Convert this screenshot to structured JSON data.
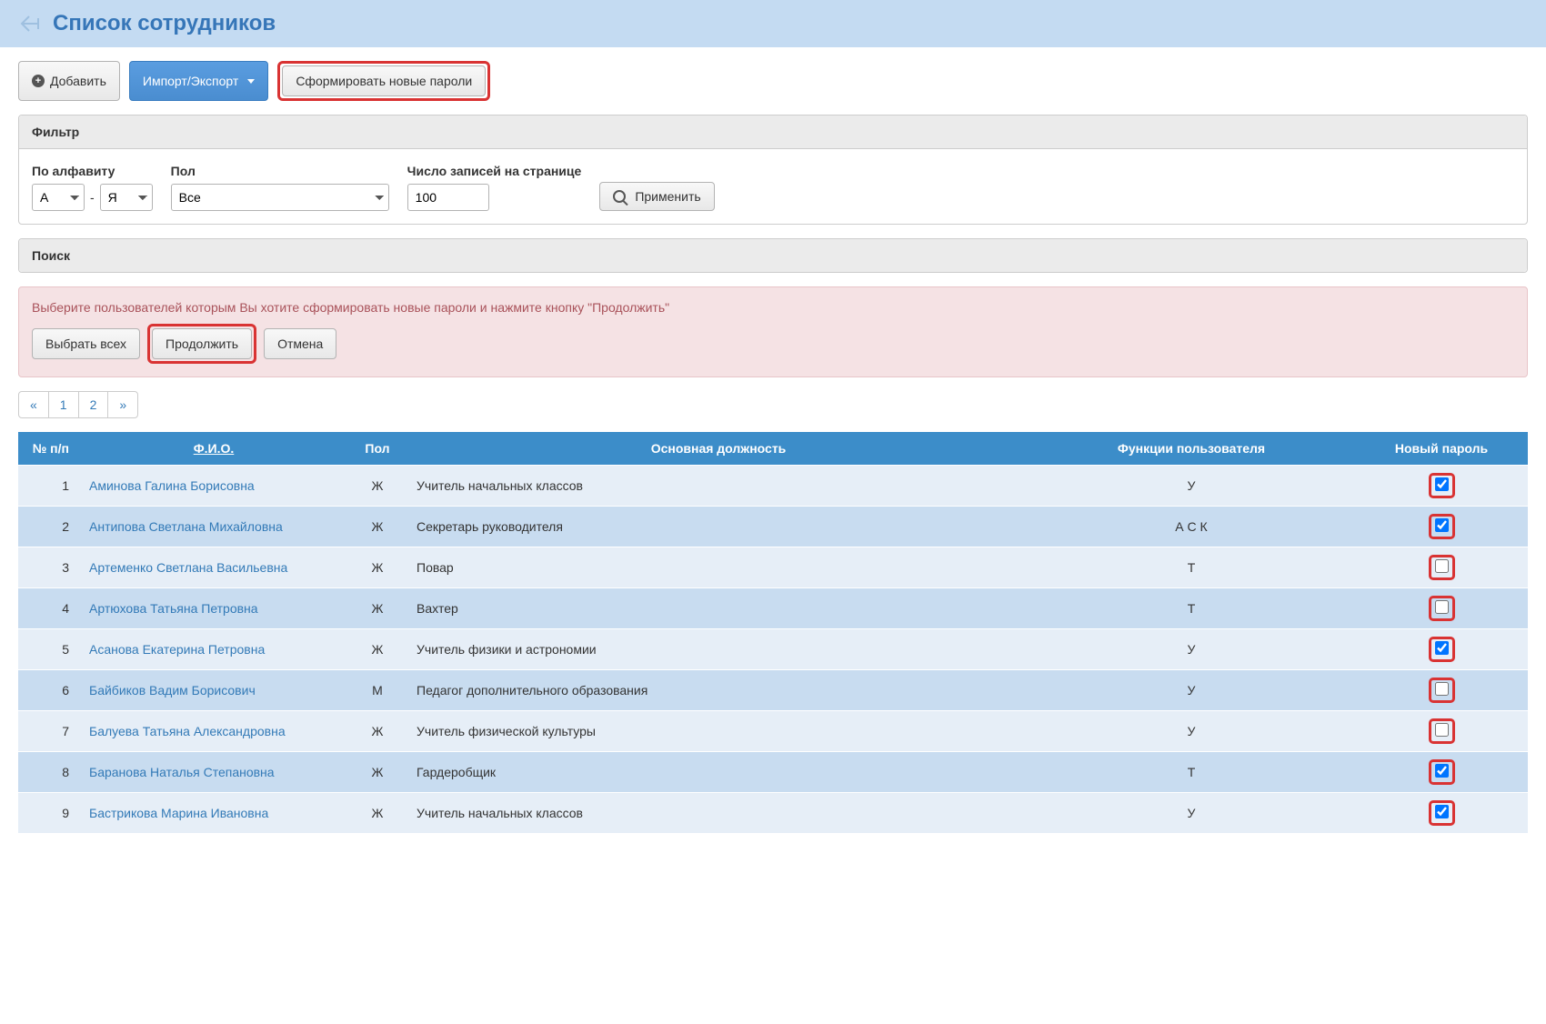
{
  "header": {
    "title": "Список сотрудников"
  },
  "toolbar": {
    "add": "Добавить",
    "import_export": "Импорт/Экспорт",
    "generate_passwords": "Сформировать новые пароли"
  },
  "filter": {
    "panel_title": "Фильтр",
    "alphabet_label": "По алфавиту",
    "alpha_from": "А",
    "alpha_to": "Я",
    "gender_label": "Пол",
    "gender_value": "Все",
    "records_label": "Число записей на странице",
    "records_value": "100",
    "apply": "Применить"
  },
  "search": {
    "panel_title": "Поиск"
  },
  "alert": {
    "message": "Выберите пользователей которым Вы хотите сформировать новые пароли и нажмите кнопку \"Продолжить\"",
    "select_all": "Выбрать всех",
    "continue": "Продолжить",
    "cancel": "Отмена"
  },
  "pagination": {
    "prev": "«",
    "p1": "1",
    "p2": "2",
    "next": "»"
  },
  "table": {
    "headers": {
      "num": "№ п/п",
      "fio": "Ф.И.О.",
      "gender": "Пол",
      "position": "Основная должность",
      "functions": "Функции пользователя",
      "newpass": "Новый пароль"
    },
    "rows": [
      {
        "n": "1",
        "name": "Аминова Галина Борисовна",
        "gender": "Ж",
        "position": "Учитель начальных классов",
        "functions": "У",
        "checked": true
      },
      {
        "n": "2",
        "name": "Антипова Светлана Михайловна",
        "gender": "Ж",
        "position": "Секретарь руководителя",
        "functions": "А С К",
        "checked": true
      },
      {
        "n": "3",
        "name": "Артеменко Светлана Васильевна",
        "gender": "Ж",
        "position": "Повар",
        "functions": "Т",
        "checked": false
      },
      {
        "n": "4",
        "name": "Артюхова Татьяна Петровна",
        "gender": "Ж",
        "position": "Вахтер",
        "functions": "Т",
        "checked": false
      },
      {
        "n": "5",
        "name": "Асанова Екатерина Петровна",
        "gender": "Ж",
        "position": "Учитель физики и астрономии",
        "functions": "У",
        "checked": true
      },
      {
        "n": "6",
        "name": "Байбиков Вадим Борисович",
        "gender": "М",
        "position": "Педагог дополнительного образования",
        "functions": "У",
        "checked": false
      },
      {
        "n": "7",
        "name": "Балуева Татьяна Александровна",
        "gender": "Ж",
        "position": "Учитель физической культуры",
        "functions": "У",
        "checked": false
      },
      {
        "n": "8",
        "name": "Баранова Наталья Степановна",
        "gender": "Ж",
        "position": "Гардеробщик",
        "functions": "Т",
        "checked": true
      },
      {
        "n": "9",
        "name": "Бастрикова Марина Ивановна",
        "gender": "Ж",
        "position": "Учитель начальных классов",
        "functions": "У",
        "checked": true
      }
    ]
  }
}
